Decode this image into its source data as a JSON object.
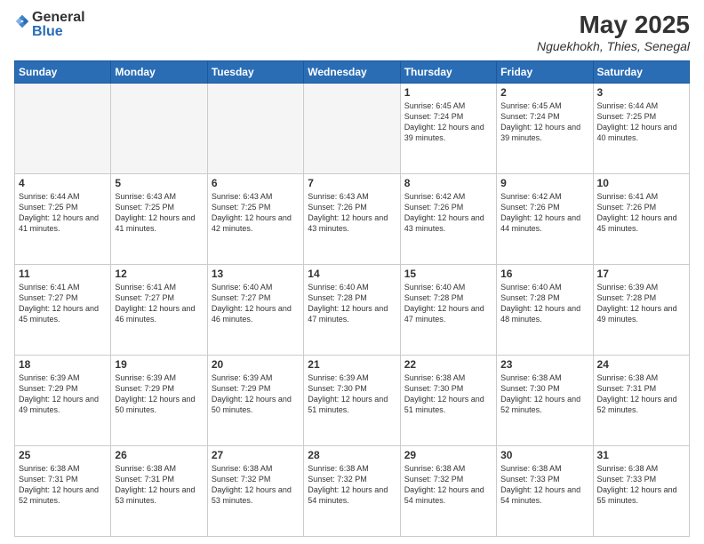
{
  "logo": {
    "general": "General",
    "blue": "Blue"
  },
  "header": {
    "title": "May 2025",
    "subtitle": "Nguekhokh, Thies, Senegal"
  },
  "weekdays": [
    "Sunday",
    "Monday",
    "Tuesday",
    "Wednesday",
    "Thursday",
    "Friday",
    "Saturday"
  ],
  "weeks": [
    [
      {
        "day": "",
        "info": "",
        "empty": true
      },
      {
        "day": "",
        "info": "",
        "empty": true
      },
      {
        "day": "",
        "info": "",
        "empty": true
      },
      {
        "day": "",
        "info": "",
        "empty": true
      },
      {
        "day": "1",
        "info": "Sunrise: 6:45 AM\nSunset: 7:24 PM\nDaylight: 12 hours and 39 minutes."
      },
      {
        "day": "2",
        "info": "Sunrise: 6:45 AM\nSunset: 7:24 PM\nDaylight: 12 hours and 39 minutes."
      },
      {
        "day": "3",
        "info": "Sunrise: 6:44 AM\nSunset: 7:25 PM\nDaylight: 12 hours and 40 minutes."
      }
    ],
    [
      {
        "day": "4",
        "info": "Sunrise: 6:44 AM\nSunset: 7:25 PM\nDaylight: 12 hours and 41 minutes."
      },
      {
        "day": "5",
        "info": "Sunrise: 6:43 AM\nSunset: 7:25 PM\nDaylight: 12 hours and 41 minutes."
      },
      {
        "day": "6",
        "info": "Sunrise: 6:43 AM\nSunset: 7:25 PM\nDaylight: 12 hours and 42 minutes."
      },
      {
        "day": "7",
        "info": "Sunrise: 6:43 AM\nSunset: 7:26 PM\nDaylight: 12 hours and 43 minutes."
      },
      {
        "day": "8",
        "info": "Sunrise: 6:42 AM\nSunset: 7:26 PM\nDaylight: 12 hours and 43 minutes."
      },
      {
        "day": "9",
        "info": "Sunrise: 6:42 AM\nSunset: 7:26 PM\nDaylight: 12 hours and 44 minutes."
      },
      {
        "day": "10",
        "info": "Sunrise: 6:41 AM\nSunset: 7:26 PM\nDaylight: 12 hours and 45 minutes."
      }
    ],
    [
      {
        "day": "11",
        "info": "Sunrise: 6:41 AM\nSunset: 7:27 PM\nDaylight: 12 hours and 45 minutes."
      },
      {
        "day": "12",
        "info": "Sunrise: 6:41 AM\nSunset: 7:27 PM\nDaylight: 12 hours and 46 minutes."
      },
      {
        "day": "13",
        "info": "Sunrise: 6:40 AM\nSunset: 7:27 PM\nDaylight: 12 hours and 46 minutes."
      },
      {
        "day": "14",
        "info": "Sunrise: 6:40 AM\nSunset: 7:28 PM\nDaylight: 12 hours and 47 minutes."
      },
      {
        "day": "15",
        "info": "Sunrise: 6:40 AM\nSunset: 7:28 PM\nDaylight: 12 hours and 47 minutes."
      },
      {
        "day": "16",
        "info": "Sunrise: 6:40 AM\nSunset: 7:28 PM\nDaylight: 12 hours and 48 minutes."
      },
      {
        "day": "17",
        "info": "Sunrise: 6:39 AM\nSunset: 7:28 PM\nDaylight: 12 hours and 49 minutes."
      }
    ],
    [
      {
        "day": "18",
        "info": "Sunrise: 6:39 AM\nSunset: 7:29 PM\nDaylight: 12 hours and 49 minutes."
      },
      {
        "day": "19",
        "info": "Sunrise: 6:39 AM\nSunset: 7:29 PM\nDaylight: 12 hours and 50 minutes."
      },
      {
        "day": "20",
        "info": "Sunrise: 6:39 AM\nSunset: 7:29 PM\nDaylight: 12 hours and 50 minutes."
      },
      {
        "day": "21",
        "info": "Sunrise: 6:39 AM\nSunset: 7:30 PM\nDaylight: 12 hours and 51 minutes."
      },
      {
        "day": "22",
        "info": "Sunrise: 6:38 AM\nSunset: 7:30 PM\nDaylight: 12 hours and 51 minutes."
      },
      {
        "day": "23",
        "info": "Sunrise: 6:38 AM\nSunset: 7:30 PM\nDaylight: 12 hours and 52 minutes."
      },
      {
        "day": "24",
        "info": "Sunrise: 6:38 AM\nSunset: 7:31 PM\nDaylight: 12 hours and 52 minutes."
      }
    ],
    [
      {
        "day": "25",
        "info": "Sunrise: 6:38 AM\nSunset: 7:31 PM\nDaylight: 12 hours and 52 minutes."
      },
      {
        "day": "26",
        "info": "Sunrise: 6:38 AM\nSunset: 7:31 PM\nDaylight: 12 hours and 53 minutes."
      },
      {
        "day": "27",
        "info": "Sunrise: 6:38 AM\nSunset: 7:32 PM\nDaylight: 12 hours and 53 minutes."
      },
      {
        "day": "28",
        "info": "Sunrise: 6:38 AM\nSunset: 7:32 PM\nDaylight: 12 hours and 54 minutes."
      },
      {
        "day": "29",
        "info": "Sunrise: 6:38 AM\nSunset: 7:32 PM\nDaylight: 12 hours and 54 minutes."
      },
      {
        "day": "30",
        "info": "Sunrise: 6:38 AM\nSunset: 7:33 PM\nDaylight: 12 hours and 54 minutes."
      },
      {
        "day": "31",
        "info": "Sunrise: 6:38 AM\nSunset: 7:33 PM\nDaylight: 12 hours and 55 minutes."
      }
    ]
  ]
}
